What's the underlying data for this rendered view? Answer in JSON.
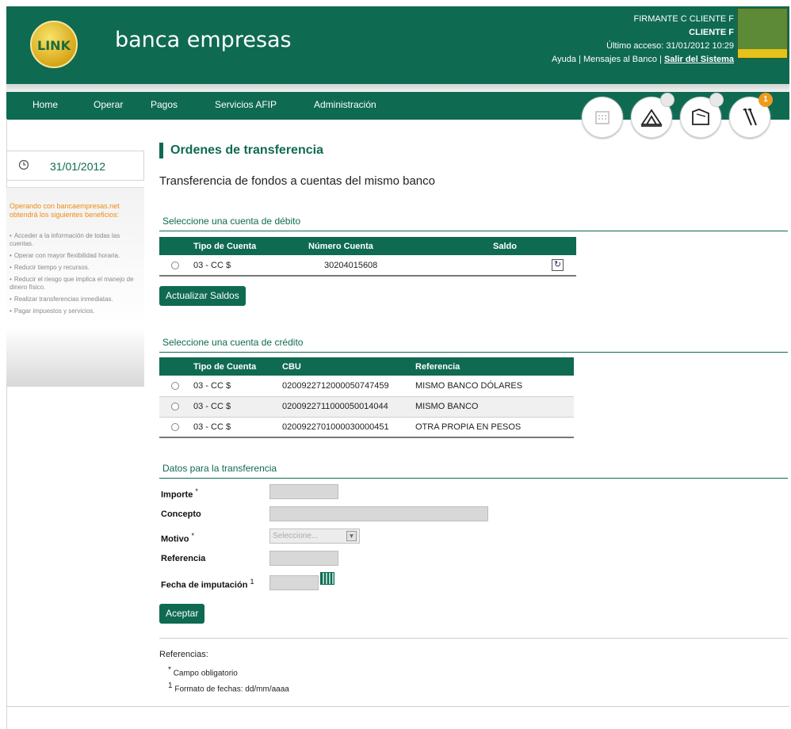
{
  "header": {
    "brand": "banca empresas",
    "logo_text": "LINK",
    "user_name": "FIRMANTE C CLIENTE F",
    "company": "CLIENTE F",
    "last_access": "Último acceso: 31/01/2012 10:29",
    "help": "Ayuda",
    "messages": "Mensajes al Banco",
    "logout": "Salir del Sistema",
    "sep": "|"
  },
  "nav": {
    "items": [
      "Home",
      "Operar",
      "Pagos",
      "Servicios AFIP",
      "Administración"
    ],
    "badge_count": "1"
  },
  "sidebar": {
    "date": "31/01/2012",
    "promo_title": "Operando con bancaempresas.net obtendrá los siguientes beneficios:",
    "benefits": [
      "Acceder a la información de todas las cuentas.",
      "Operar con mayor flexibilidad horaria.",
      "Reducir tiempo y recursos.",
      "Reducir el riesgo que implica el manejo de dinero físico.",
      "Realizar transferencias inmediatas.",
      "Pagar impuestos y servicios."
    ]
  },
  "main": {
    "title": "Ordenes de transferencia",
    "subtitle": "Transferencia de fondos a cuentas del mismo banco",
    "debit": {
      "section_title": "Seleccione una cuenta de débito",
      "headers": [
        "Tipo de Cuenta",
        "Número Cuenta",
        "Saldo"
      ],
      "rows": [
        {
          "tipo": "03 - CC $",
          "numero": "30204015608"
        }
      ],
      "refresh_button": "Actualizar Saldos"
    },
    "credit": {
      "section_title": "Seleccione una cuenta de crédito",
      "headers": [
        "Tipo de Cuenta",
        "CBU",
        "Referencia"
      ],
      "rows": [
        {
          "tipo": "03 - CC $",
          "cbu": "0200922712000050747459",
          "ref": "MISMO BANCO DÓLARES"
        },
        {
          "tipo": "03 - CC $",
          "cbu": "0200922711000050014044",
          "ref": "MISMO BANCO"
        },
        {
          "tipo": "03 - CC $",
          "cbu": "0200922701000030000451",
          "ref": "OTRA PROPIA EN PESOS"
        }
      ]
    },
    "form": {
      "section_title": "Datos para la transferencia",
      "importe": "Importe",
      "concepto": "Concepto",
      "motivo": "Motivo",
      "motivo_placeholder": "Seleccione...",
      "referencia": "Referencia",
      "fecha": "Fecha de imputación",
      "required_mark": "*",
      "note_mark": "1",
      "submit": "Aceptar"
    },
    "references": {
      "title": "Referencias:",
      "req": "Campo obligatorio",
      "date_format": "Formato de fechas: dd/mm/aaaa"
    }
  },
  "colors": {
    "brand_green": "#0f6a52",
    "accent_orange": "#f08a14",
    "badge": "#f09a1c"
  }
}
